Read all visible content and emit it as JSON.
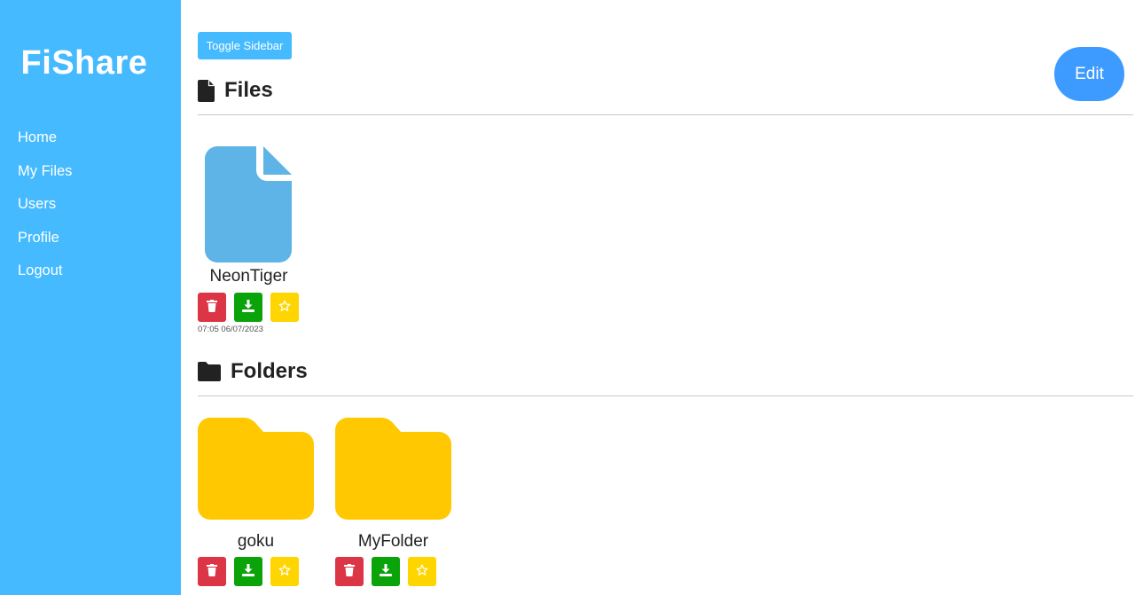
{
  "sidebar": {
    "brand": "FiShare",
    "items": [
      {
        "label": "Home"
      },
      {
        "label": "My Files"
      },
      {
        "label": "Users"
      },
      {
        "label": "Profile"
      },
      {
        "label": "Logout"
      }
    ]
  },
  "toolbar": {
    "toggle_label": "Toggle Sidebar",
    "edit_label": "Edit"
  },
  "files": {
    "heading": "Files",
    "icon": "file-icon",
    "items": [
      {
        "name": "NeonTiger",
        "timestamp": "07:05 06/07/2023",
        "icon": "document-icon"
      }
    ]
  },
  "folders": {
    "heading": "Folders",
    "icon": "folder-icon",
    "items": [
      {
        "name": "goku",
        "icon": "folder-icon"
      },
      {
        "name": "MyFolder",
        "icon": "folder-icon"
      }
    ]
  },
  "colors": {
    "sidebar": "#46baff",
    "edit": "#3d9bff",
    "delete": "#dc3545",
    "download": "#0aa30a",
    "favorite": "#ffd500",
    "folder": "#ffc800",
    "file": "#5eb4e6"
  }
}
